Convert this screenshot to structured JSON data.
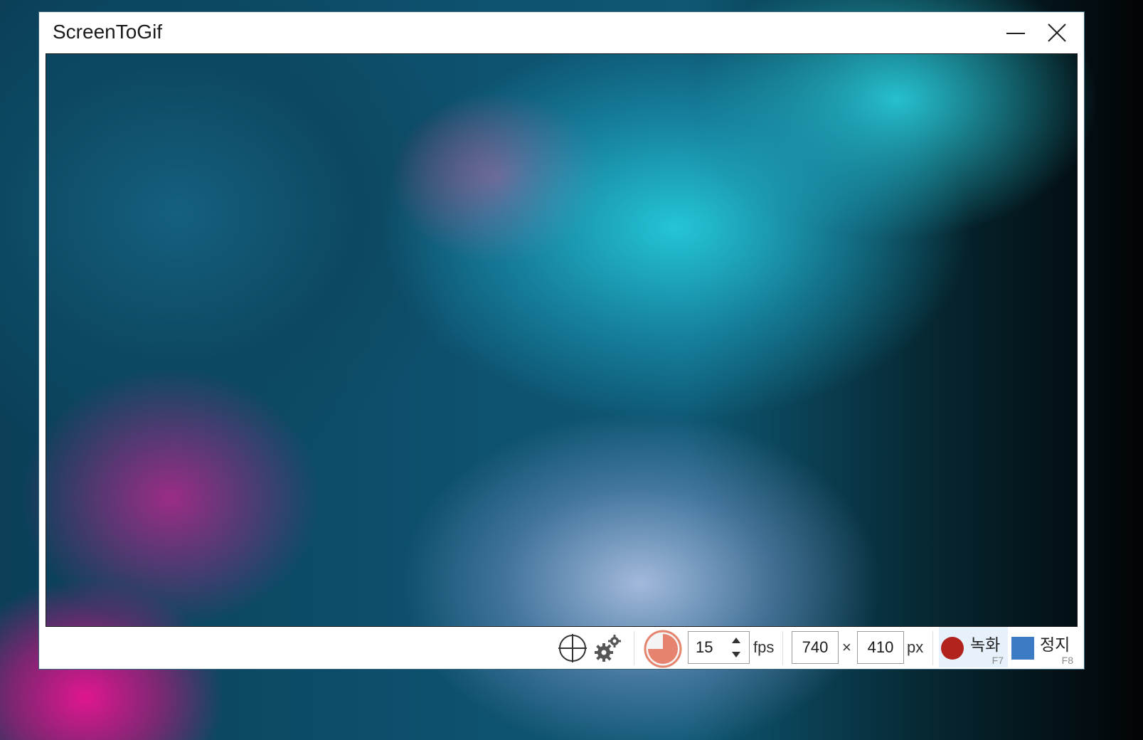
{
  "window": {
    "title": "ScreenToGif"
  },
  "toolbar": {
    "fps_value": "15",
    "fps_unit": "fps",
    "width_value": "740",
    "times_symbol": "×",
    "height_value": "410",
    "size_unit": "px",
    "record_label": "녹화",
    "record_key": "F7",
    "stop_label": "정지",
    "stop_key": "F8"
  },
  "icons": {
    "crosshair": "crosshair-icon",
    "settings": "gears-icon",
    "timer": "pie-timer-icon",
    "record": "record-icon",
    "stop": "stop-icon"
  },
  "colors": {
    "record_dot": "#b3231e",
    "stop_square": "#3d7cc4",
    "timer_fill": "#e6836e",
    "record_bg": "#e6f1fb"
  }
}
